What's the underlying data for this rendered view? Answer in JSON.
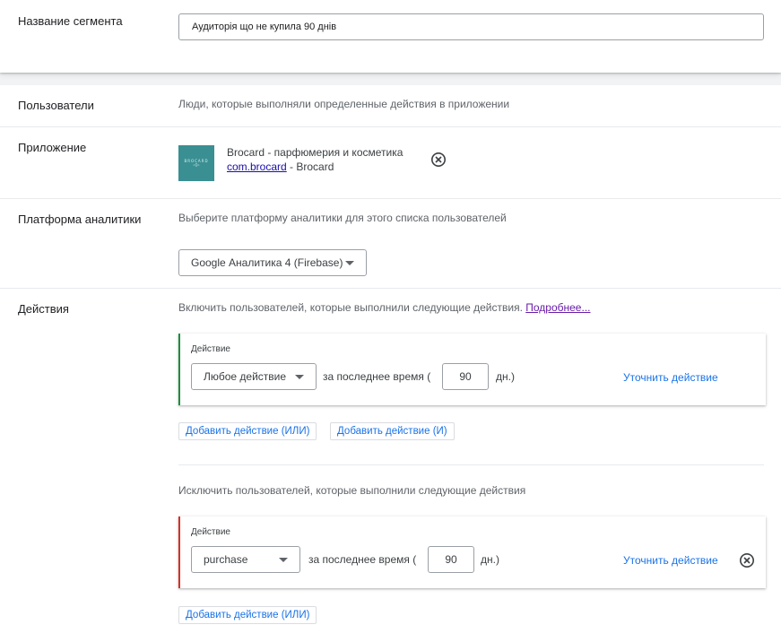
{
  "segment": {
    "label": "Название сегмента",
    "value": "Аудиторія що не купила 90 днів"
  },
  "users": {
    "label": "Пользователи",
    "description": "Люди, которые выполняли определенные действия в приложении"
  },
  "app": {
    "label": "Приложение",
    "logo_text_top": "BROCARD",
    "logo_text_bottom": "◦◊◦",
    "name": "Brocard - парфюмерия и косметика",
    "package": "com.brocard",
    "developer": " - Brocard"
  },
  "platform": {
    "label": "Платформа аналитики",
    "description": "Выберите платформу аналитики для этого списка пользователей",
    "selected": "Google Аналитика 4 (Firebase)"
  },
  "actions": {
    "label": "Действия",
    "include_text": "Включить пользователей, которые выполнили следующие действия.",
    "learn_more": "Подробнее...",
    "include_card": {
      "title": "Действие",
      "selected": "Любое действие",
      "period_prefix": "за последнее время (",
      "days": "90",
      "period_suffix": "дн.)",
      "refine": "Уточнить действие"
    },
    "add_or": "Добавить действие (ИЛИ)",
    "add_and": "Добавить действие (И)",
    "exclude_text": "Исключить пользователей, которые выполнили следующие действия",
    "exclude_card": {
      "title": "Действие",
      "selected": "purchase",
      "period_prefix": "за последнее время (",
      "days": "90",
      "period_suffix": "дн.)",
      "refine": "Уточнить действие"
    },
    "exclude_add_or": "Добавить действие (ИЛИ)"
  },
  "colors": {
    "include_bar": "#1e8e3e",
    "exclude_bar": "#d93025",
    "link": "#1a73e8"
  }
}
